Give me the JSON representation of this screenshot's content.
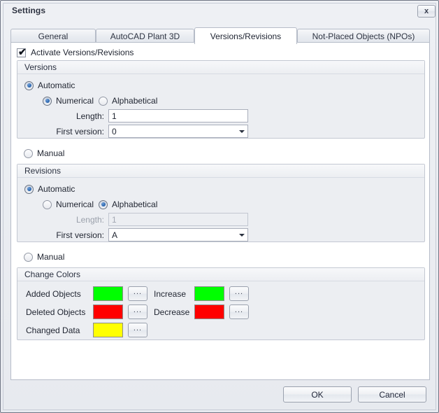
{
  "window": {
    "title": "Settings",
    "close_label": "x"
  },
  "tabs": [
    {
      "label": "General",
      "active": false
    },
    {
      "label": "AutoCAD Plant 3D",
      "active": false
    },
    {
      "label": "Versions/Revisions",
      "active": true
    },
    {
      "label": "Not-Placed Objects (NPOs)",
      "active": false
    }
  ],
  "activate": {
    "label": "Activate Versions/Revisions",
    "checked": true,
    "check_glyph": "✔"
  },
  "versions": {
    "group_title": "Versions",
    "automatic_label": "Automatic",
    "automatic_selected": true,
    "numerical_label": "Numerical",
    "numerical_selected": true,
    "alphabetical_label": "Alphabetical",
    "alphabetical_selected": false,
    "length_label": "Length:",
    "length_value": "1",
    "length_disabled": false,
    "first_version_label": "First version:",
    "first_version_value": "0",
    "manual_label": "Manual",
    "manual_selected": false
  },
  "revisions": {
    "group_title": "Revisions",
    "automatic_label": "Automatic",
    "automatic_selected": true,
    "numerical_label": "Numerical",
    "numerical_selected": false,
    "alphabetical_label": "Alphabetical",
    "alphabetical_selected": true,
    "length_label": "Length:",
    "length_value": "1",
    "length_disabled": true,
    "first_version_label": "First version:",
    "first_version_value": "A",
    "manual_label": "Manual",
    "manual_selected": false
  },
  "change_colors": {
    "group_title": "Change Colors",
    "browse_label": "...",
    "rows_left": [
      {
        "label": "Added Objects",
        "color": "#00FF00"
      },
      {
        "label": "Deleted Objects",
        "color": "#FF0000"
      },
      {
        "label": "Changed Data",
        "color": "#FFFF00"
      }
    ],
    "rows_right": [
      {
        "label": "Increase",
        "color": "#00FF00"
      },
      {
        "label": "Decrease",
        "color": "#FF0000"
      }
    ]
  },
  "footer": {
    "ok_label": "OK",
    "cancel_label": "Cancel"
  }
}
